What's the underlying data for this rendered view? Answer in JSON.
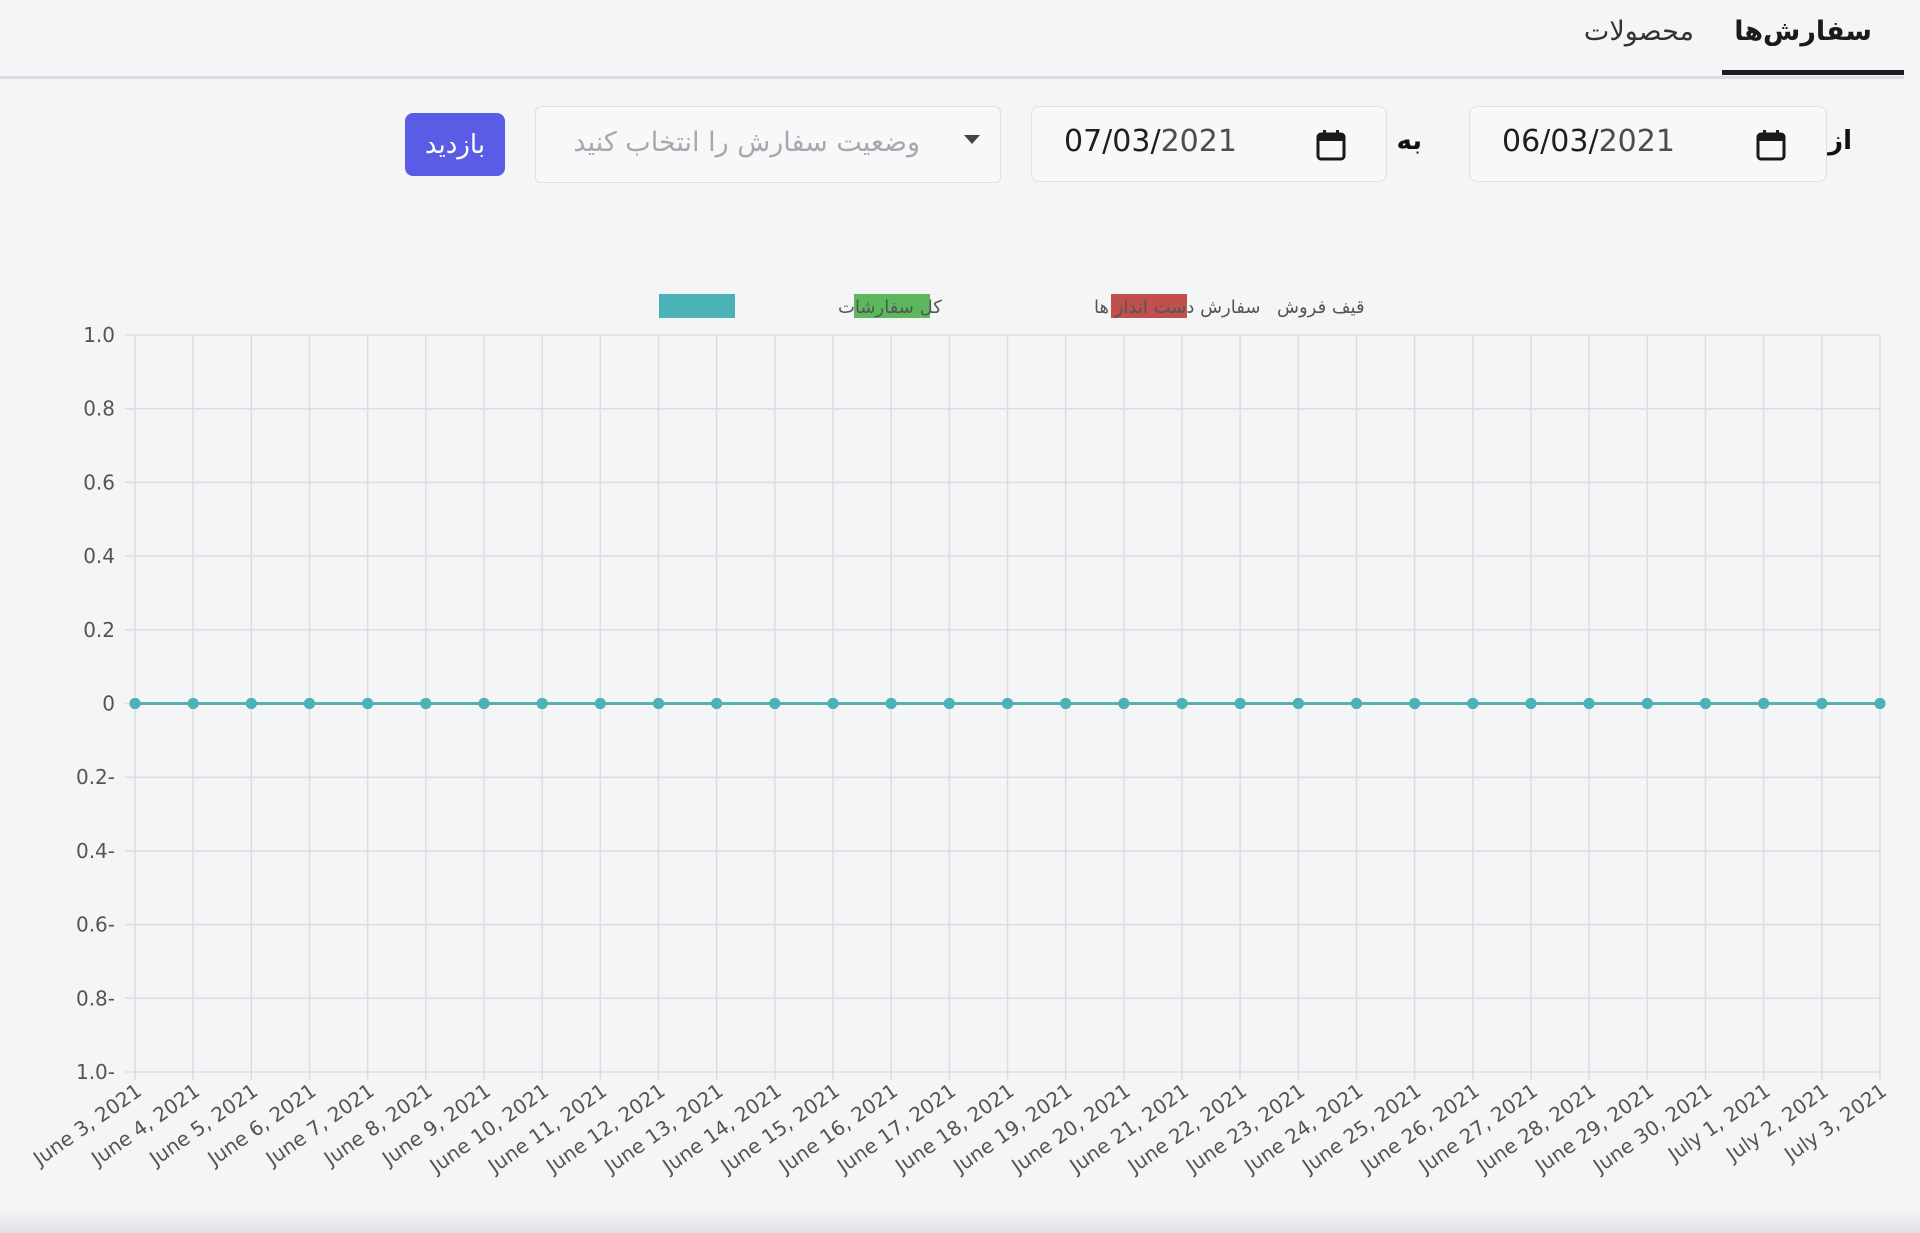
{
  "tabs": {
    "orders": "سفارش‌ها",
    "products": "محصولات"
  },
  "filters": {
    "from_label": "از",
    "from_date_day_month": "06/03/",
    "from_date_year": "2021",
    "to_label": "به",
    "to_date_day_month": "07/03/",
    "to_date_year": "2021",
    "status_placeholder": "وضعیت سفارش را انتخاب کنید",
    "visit_button": "بازدید",
    "calendar_icon": "calendar-icon",
    "dropdown_icon": "caret-down-icon"
  },
  "chart_data": {
    "type": "line",
    "legend_position": "top-center",
    "grid": true,
    "ylim": [
      -1.0,
      1.0
    ],
    "y_ticks": [
      "1.0",
      "0.8",
      "0.6",
      "0.4",
      "0.2",
      "0",
      "0.2-",
      "0.4-",
      "0.6-",
      "0.8-",
      "1.0-"
    ],
    "x": [
      "June 3, 2021",
      "June 4, 2021",
      "June 5, 2021",
      "June 6, 2021",
      "June 7, 2021",
      "June 8, 2021",
      "June 9, 2021",
      "June 10, 2021",
      "June 11, 2021",
      "June 12, 2021",
      "June 13, 2021",
      "June 14, 2021",
      "June 15, 2021",
      "June 16, 2021",
      "June 17, 2021",
      "June 18, 2021",
      "June 19, 2021",
      "June 20, 2021",
      "June 21, 2021",
      "June 22, 2021",
      "June 23, 2021",
      "June 24, 2021",
      "June 25, 2021",
      "June 26, 2021",
      "June 27, 2021",
      "June 28, 2021",
      "June 29, 2021",
      "June 30, 2021",
      "July 1, 2021",
      "July 2, 2021",
      "July 3, 2021"
    ],
    "series": [
      {
        "name": "قیف فروش",
        "color": "#c0504d",
        "values": [
          0,
          0,
          0,
          0,
          0,
          0,
          0,
          0,
          0,
          0,
          0,
          0,
          0,
          0,
          0,
          0,
          0,
          0,
          0,
          0,
          0,
          0,
          0,
          0,
          0,
          0,
          0,
          0,
          0,
          0,
          0
        ]
      },
      {
        "name": "سفارش دست انداز ها",
        "color": "#5cb85c",
        "values": [
          0,
          0,
          0,
          0,
          0,
          0,
          0,
          0,
          0,
          0,
          0,
          0,
          0,
          0,
          0,
          0,
          0,
          0,
          0,
          0,
          0,
          0,
          0,
          0,
          0,
          0,
          0,
          0,
          0,
          0,
          0
        ]
      },
      {
        "name": "کل سفارشات",
        "color": "#4bb3b8",
        "values": [
          0,
          0,
          0,
          0,
          0,
          0,
          0,
          0,
          0,
          0,
          0,
          0,
          0,
          0,
          0,
          0,
          0,
          0,
          0,
          0,
          0,
          0,
          0,
          0,
          0,
          0,
          0,
          0,
          0,
          0,
          0
        ]
      }
    ]
  }
}
